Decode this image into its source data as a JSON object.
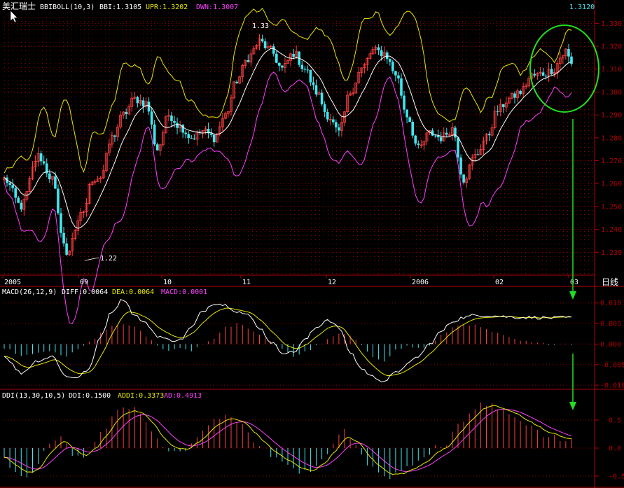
{
  "colors": {
    "background": "#000000",
    "frame": "#b00000",
    "grid": "#8a0000",
    "up_candle": "#ff4040",
    "down_candle": "#40e8f0",
    "label_white": "#ffffff",
    "yellow": "#e8e800",
    "magenta": "#ff40ff",
    "cyan_text": "#40e8f0",
    "annotation": "#20e020"
  },
  "price_panel": {
    "title": "美汇瑞士",
    "indicator_name": "BBIBOLL(10,3)",
    "bbi_label": "BBI:1.3105",
    "upr_label": "UPR:1.3202",
    "dwn_label": "DWN:1.3007",
    "last_price": "1.3120",
    "high_annotation": "1.33",
    "low_annotation": "1.22",
    "x_axis_labels": [
      "2005",
      "09",
      "10",
      "11",
      "12",
      "2006",
      "02",
      "03"
    ],
    "x_axis_unit": "日线"
  },
  "macd_panel": {
    "indicator_name": "MACD(26,12,9)",
    "diff_label": "DIFF:0.0064",
    "dea_label": "DEA:0.0064",
    "macd_label": "MACD:0.0001"
  },
  "ddi_panel": {
    "indicator_name": "DDI(13,30,10,5)",
    "ddi_label": "DDI:0.1500",
    "addi_label": "ADDI:0.3373",
    "ad_label": "AD:0.4913"
  },
  "chart_data": [
    {
      "type": "candlestick",
      "ylim": [
        1.22,
        1.335
      ],
      "y_ticks": [
        "1.330",
        "1.320",
        "1.310",
        "1.300",
        "1.290",
        "1.280",
        "1.270",
        "1.260",
        "1.250",
        "1.240",
        "1.230"
      ],
      "x_ticks": [
        "2005",
        "09",
        "10",
        "11",
        "12",
        "2006",
        "02",
        "03"
      ],
      "close_anchors": [
        [
          0,
          1.262
        ],
        [
          6,
          1.25
        ],
        [
          12,
          1.272
        ],
        [
          17,
          1.262
        ],
        [
          20,
          1.24
        ],
        [
          22,
          1.228
        ],
        [
          25,
          1.24
        ],
        [
          28,
          1.248
        ],
        [
          31,
          1.262
        ],
        [
          34,
          1.263
        ],
        [
          38,
          1.28
        ],
        [
          42,
          1.29
        ],
        [
          46,
          1.297
        ],
        [
          50,
          1.295
        ],
        [
          54,
          1.275
        ],
        [
          58,
          1.29
        ],
        [
          62,
          1.285
        ],
        [
          66,
          1.28
        ],
        [
          70,
          1.283
        ],
        [
          74,
          1.28
        ],
        [
          78,
          1.29
        ],
        [
          82,
          1.305
        ],
        [
          86,
          1.315
        ],
        [
          90,
          1.322
        ],
        [
          94,
          1.318
        ],
        [
          98,
          1.31
        ],
        [
          102,
          1.317
        ],
        [
          106,
          1.31
        ],
        [
          110,
          1.3
        ],
        [
          114,
          1.29
        ],
        [
          118,
          1.282
        ],
        [
          122,
          1.3
        ],
        [
          126,
          1.31
        ],
        [
          130,
          1.318
        ],
        [
          134,
          1.317
        ],
        [
          138,
          1.308
        ],
        [
          142,
          1.29
        ],
        [
          146,
          1.275
        ],
        [
          150,
          1.282
        ],
        [
          154,
          1.28
        ],
        [
          158,
          1.284
        ],
        [
          162,
          1.262
        ],
        [
          166,
          1.272
        ],
        [
          170,
          1.28
        ],
        [
          174,
          1.292
        ],
        [
          178,
          1.297
        ],
        [
          182,
          1.3
        ],
        [
          186,
          1.307
        ],
        [
          190,
          1.308
        ],
        [
          194,
          1.31
        ],
        [
          196,
          1.315
        ],
        [
          198,
          1.318
        ],
        [
          200,
          1.312
        ]
      ],
      "series": [
        {
          "name": "BBI",
          "last": 1.3105
        },
        {
          "name": "UPR",
          "last": 1.3202
        },
        {
          "name": "DWN",
          "last": 1.3007
        }
      ],
      "annotations": [
        "1.33",
        "1.22"
      ]
    },
    {
      "type": "bar",
      "ylim": [
        -0.011,
        0.012
      ],
      "y_ticks": [
        "0.010",
        "0.005",
        "0.000",
        "-0.005",
        "-0.010"
      ],
      "macd_anchors": [
        [
          0,
          -0.001
        ],
        [
          6,
          -0.003
        ],
        [
          12,
          -0.002
        ],
        [
          17,
          -0.002
        ],
        [
          22,
          -0.003
        ],
        [
          26,
          -0.0015
        ],
        [
          30,
          0.0005
        ],
        [
          34,
          0.0025
        ],
        [
          38,
          0.0045
        ],
        [
          42,
          0.005
        ],
        [
          46,
          0.004
        ],
        [
          50,
          0.002
        ],
        [
          54,
          -0.0005
        ],
        [
          58,
          -0.0015
        ],
        [
          62,
          -0.001
        ],
        [
          66,
          -0.0015
        ],
        [
          70,
          0.0
        ],
        [
          74,
          0.0015
        ],
        [
          78,
          0.004
        ],
        [
          82,
          0.005
        ],
        [
          86,
          0.004
        ],
        [
          90,
          0.002
        ],
        [
          94,
          0.0005
        ],
        [
          98,
          -0.001
        ],
        [
          102,
          -0.003
        ],
        [
          106,
          -0.002
        ],
        [
          110,
          -0.0005
        ],
        [
          114,
          0.001
        ],
        [
          118,
          0.0025
        ],
        [
          122,
          0.002
        ],
        [
          126,
          -0.0005
        ],
        [
          130,
          -0.003
        ],
        [
          134,
          -0.004
        ],
        [
          138,
          -0.0015
        ],
        [
          142,
          -0.0005
        ],
        [
          146,
          -0.001
        ],
        [
          150,
          -0.0005
        ],
        [
          154,
          0.002
        ],
        [
          158,
          0.004
        ],
        [
          162,
          0.005
        ],
        [
          166,
          0.0045
        ],
        [
          170,
          0.0035
        ],
        [
          174,
          0.0025
        ],
        [
          178,
          0.0015
        ],
        [
          182,
          0.0008
        ],
        [
          186,
          0.0003
        ],
        [
          190,
          0.0001
        ],
        [
          200,
          0.0001
        ]
      ],
      "diff_anchors": [
        [
          0,
          -0.003
        ],
        [
          6,
          -0.007
        ],
        [
          12,
          -0.004
        ],
        [
          17,
          -0.003
        ],
        [
          22,
          -0.008
        ],
        [
          26,
          -0.008
        ],
        [
          30,
          -0.006
        ],
        [
          34,
          0.002
        ],
        [
          38,
          0.008
        ],
        [
          42,
          0.011
        ],
        [
          46,
          0.007
        ],
        [
          50,
          0.005
        ],
        [
          54,
          0.002
        ],
        [
          58,
          0.001
        ],
        [
          62,
          0.001
        ],
        [
          66,
          0.004
        ],
        [
          70,
          0.008
        ],
        [
          74,
          0.01
        ],
        [
          78,
          0.0095
        ],
        [
          82,
          0.008
        ],
        [
          86,
          0.007
        ],
        [
          90,
          0.004
        ],
        [
          94,
          0.0005
        ],
        [
          98,
          -0.002
        ],
        [
          102,
          -0.002
        ],
        [
          106,
          0.001
        ],
        [
          110,
          0.004
        ],
        [
          114,
          0.006
        ],
        [
          118,
          0.004
        ],
        [
          122,
          -0.002
        ],
        [
          126,
          -0.006
        ],
        [
          130,
          -0.008
        ],
        [
          134,
          -0.009
        ],
        [
          138,
          -0.007
        ],
        [
          142,
          -0.005
        ],
        [
          146,
          -0.003
        ],
        [
          150,
          0.0
        ],
        [
          154,
          0.003
        ],
        [
          158,
          0.0055
        ],
        [
          162,
          0.0065
        ],
        [
          166,
          0.007
        ],
        [
          170,
          0.007
        ],
        [
          174,
          0.0068
        ],
        [
          178,
          0.0066
        ],
        [
          182,
          0.0065
        ],
        [
          186,
          0.0065
        ],
        [
          190,
          0.0064
        ],
        [
          200,
          0.0064
        ]
      ],
      "series": [
        {
          "name": "DIFF",
          "last": 0.0064
        },
        {
          "name": "DEA",
          "last": 0.0064
        },
        {
          "name": "MACD",
          "last": 0.0001
        }
      ]
    },
    {
      "type": "bar",
      "ylim": [
        -0.7,
        0.85
      ],
      "y_ticks": [
        "0.5",
        "0.0",
        "-0.5"
      ],
      "ddi_anchors": [
        [
          0,
          -0.2
        ],
        [
          4,
          -0.4
        ],
        [
          8,
          -0.5
        ],
        [
          12,
          -0.3
        ],
        [
          16,
          0.1
        ],
        [
          20,
          0.2
        ],
        [
          24,
          -0.1
        ],
        [
          28,
          -0.2
        ],
        [
          32,
          0.1
        ],
        [
          36,
          0.4
        ],
        [
          40,
          0.7
        ],
        [
          44,
          0.75
        ],
        [
          48,
          0.6
        ],
        [
          52,
          0.3
        ],
        [
          56,
          0.0
        ],
        [
          60,
          -0.1
        ],
        [
          64,
          0.0
        ],
        [
          68,
          0.2
        ],
        [
          72,
          0.4
        ],
        [
          76,
          0.55
        ],
        [
          80,
          0.55
        ],
        [
          84,
          0.4
        ],
        [
          88,
          0.15
        ],
        [
          92,
          -0.05
        ],
        [
          96,
          -0.2
        ],
        [
          100,
          -0.3
        ],
        [
          104,
          -0.45
        ],
        [
          108,
          -0.4
        ],
        [
          112,
          -0.2
        ],
        [
          116,
          0.1
        ],
        [
          120,
          0.3
        ],
        [
          124,
          0.05
        ],
        [
          128,
          -0.3
        ],
        [
          132,
          -0.45
        ],
        [
          136,
          -0.5
        ],
        [
          140,
          -0.45
        ],
        [
          144,
          -0.3
        ],
        [
          148,
          -0.15
        ],
        [
          152,
          0.0
        ],
        [
          156,
          0.1
        ],
        [
          160,
          0.4
        ],
        [
          164,
          0.65
        ],
        [
          168,
          0.8
        ],
        [
          172,
          0.75
        ],
        [
          176,
          0.65
        ],
        [
          180,
          0.55
        ],
        [
          184,
          0.45
        ],
        [
          188,
          0.3
        ],
        [
          192,
          0.2
        ],
        [
          200,
          0.15
        ]
      ],
      "series": [
        {
          "name": "DDI",
          "last": 0.15
        },
        {
          "name": "ADDI",
          "last": 0.3373
        },
        {
          "name": "AD",
          "last": 0.4913
        }
      ]
    }
  ]
}
